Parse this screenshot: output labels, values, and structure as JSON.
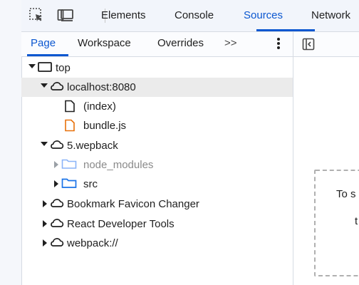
{
  "main_tabs": [
    "Elements",
    "Console",
    "Sources",
    "Network"
  ],
  "active_main_tab": "Sources",
  "sub_tabs": [
    "Page",
    "Workspace",
    "Overrides"
  ],
  "active_sub_tab": "Page",
  "more_tabs_label": ">>",
  "tree": {
    "top": "top",
    "host": "localhost:8080",
    "index": "(index)",
    "bundle": "bundle.js",
    "webpack5": "5.wepback",
    "node_modules": "node_modules",
    "src": "src",
    "bookmark": "Bookmark Favicon Changer",
    "react": "React Developer Tools",
    "webpack_scheme": "webpack://"
  },
  "editor_hint": {
    "line1": "To s",
    "line2": "t"
  },
  "colors": {
    "accent": "#0b57d0",
    "bundle_file_icon": "#e8710a",
    "folder_icon": "#1a73e8"
  },
  "icons": {
    "inspect": "inspect-element-icon",
    "device": "device-toolbar-icon",
    "sidebar_toggle": "toggle-navigator-icon"
  }
}
